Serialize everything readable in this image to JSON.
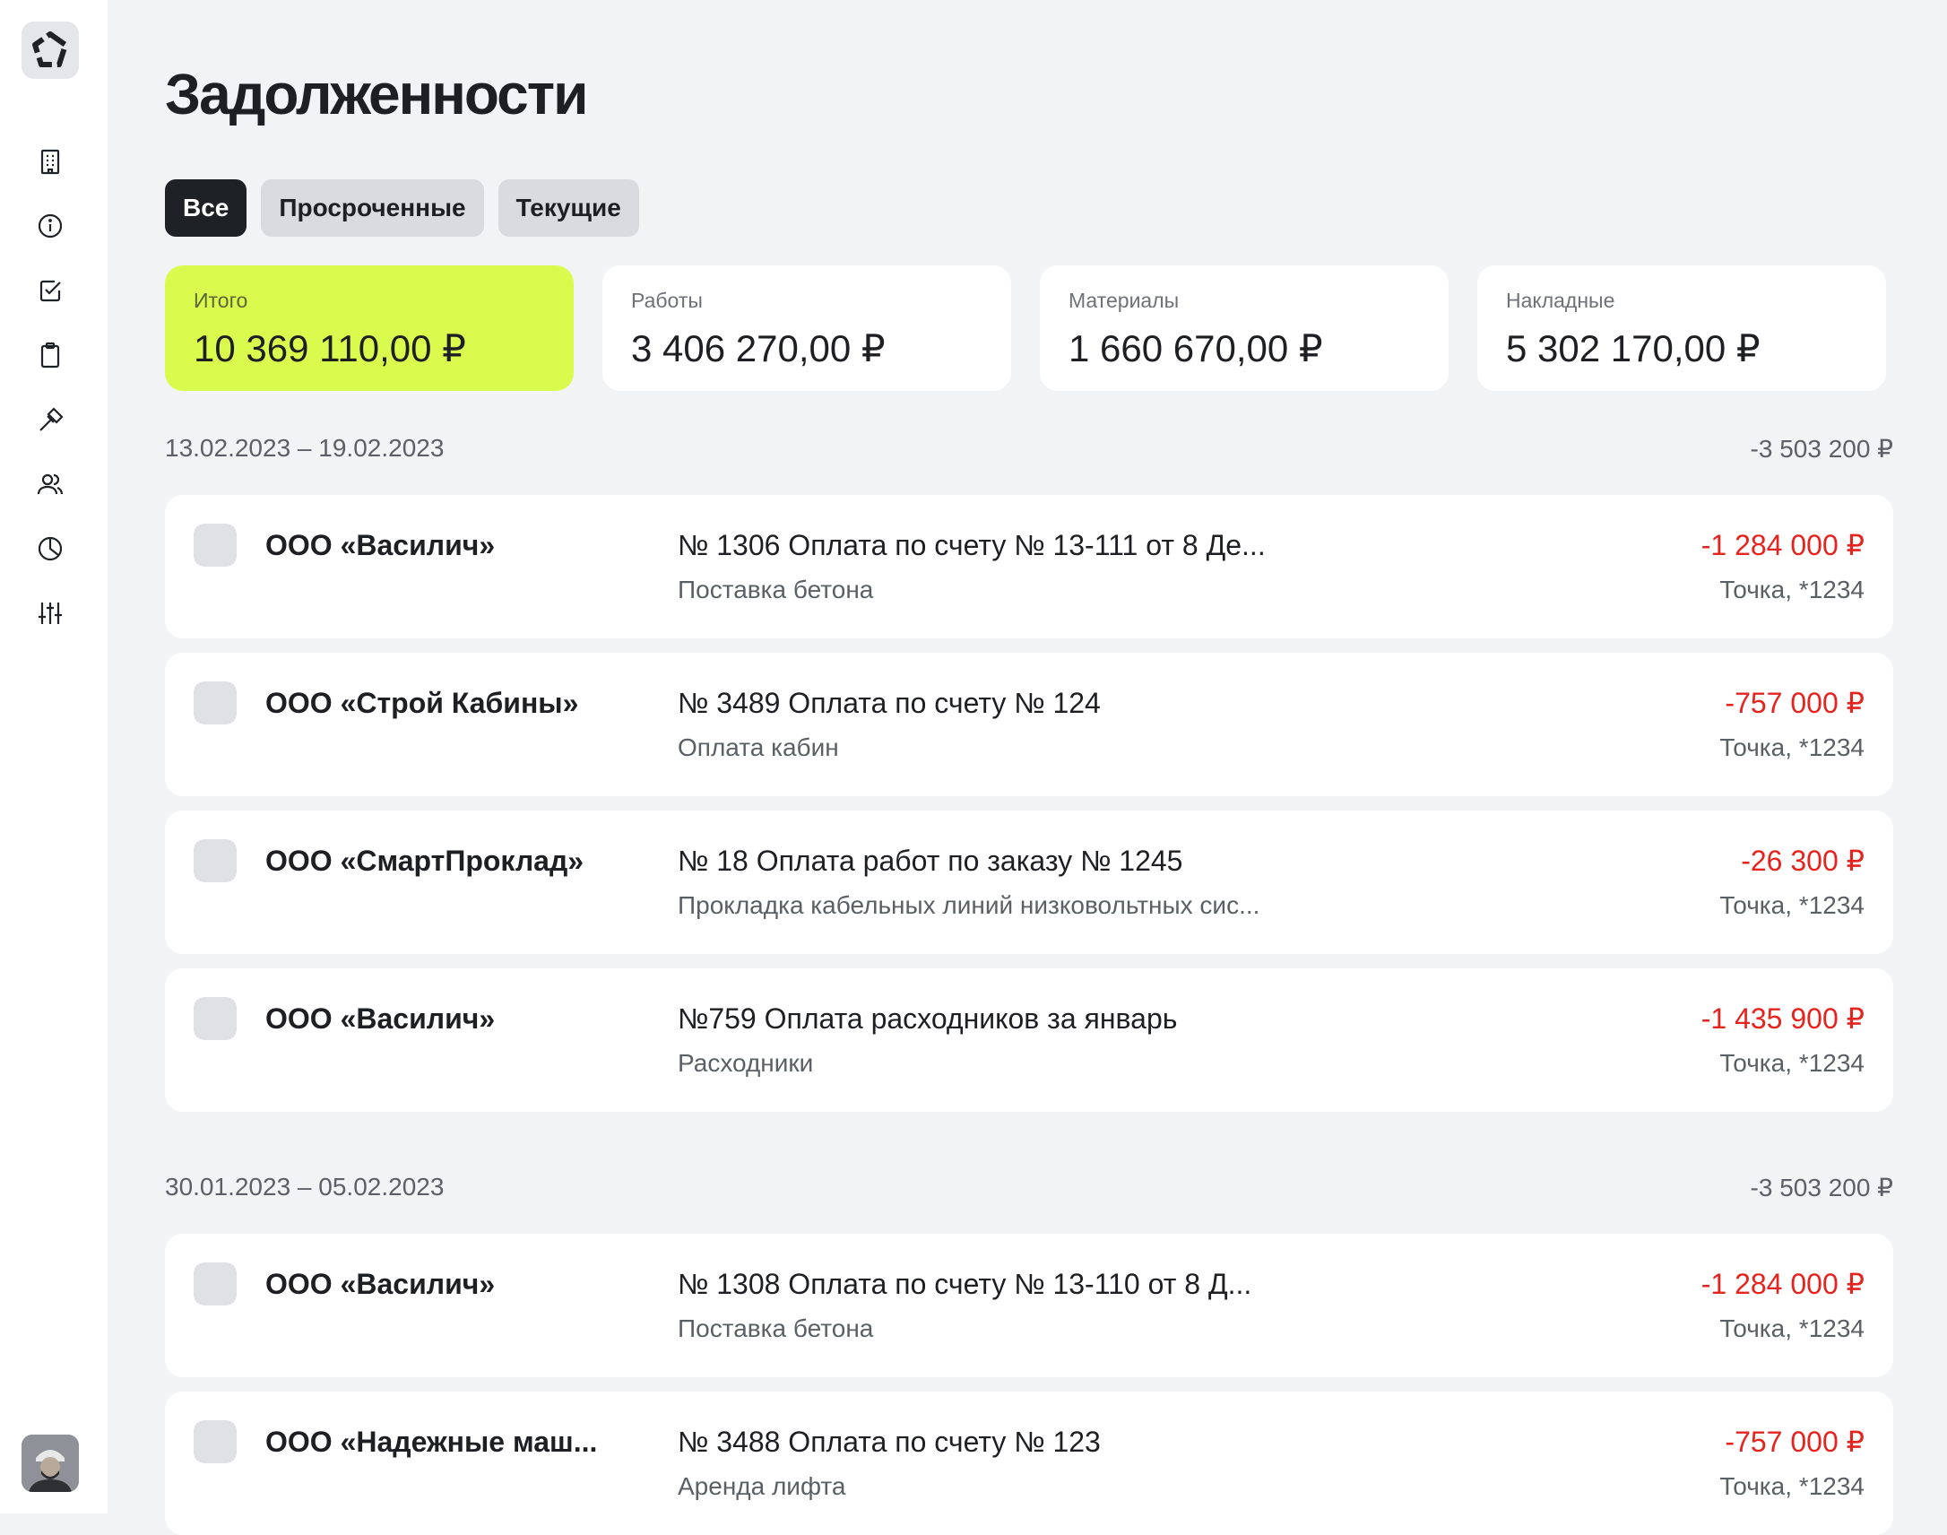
{
  "sidebar": {
    "items": [
      {
        "icon": "building-icon"
      },
      {
        "icon": "info-icon"
      },
      {
        "icon": "checkbox-icon"
      },
      {
        "icon": "clipboard-icon"
      },
      {
        "icon": "hammer-icon"
      },
      {
        "icon": "users-icon"
      },
      {
        "icon": "pie-chart-icon"
      },
      {
        "icon": "sliders-icon"
      }
    ]
  },
  "page": {
    "title": "Задолженности"
  },
  "filters": {
    "all": "Все",
    "overdue": "Просроченные",
    "current": "Текущие",
    "active": "all"
  },
  "summary": [
    {
      "label": "Итого",
      "value": "10 369 110,00 ₽"
    },
    {
      "label": "Работы",
      "value": "3 406 270,00 ₽"
    },
    {
      "label": "Материалы",
      "value": "1 660 670,00 ₽"
    },
    {
      "label": "Накладные",
      "value": "5 302 170,00 ₽"
    }
  ],
  "groups": [
    {
      "period": "13.02.2023 – 19.02.2023",
      "total": "-3 503 200 ₽",
      "rows": [
        {
          "company": "ООО «Василич»",
          "description": "№ 1306 Оплата по счету № 13-111 от 8 Де...",
          "subdescription": "Поставка бетона",
          "amount": "-1 284 000 ₽",
          "account": "Точка, *1234"
        },
        {
          "company": "ООО «Строй Кабины»",
          "description": "№ 3489  Оплата по счету № 124",
          "subdescription": "Оплата кабин",
          "amount": "-757 000 ₽",
          "account": "Точка, *1234"
        },
        {
          "company": "ООО «СмартПроклад»",
          "description": "№ 18 Оплата работ по заказу № 1245",
          "subdescription": "Прокладка кабельных линий низковольтных сис...",
          "amount": "-26 300 ₽",
          "account": "Точка, *1234"
        },
        {
          "company": "ООО «Василич»",
          "description": "№759 Оплата расходников за январь",
          "subdescription": "Расходники",
          "amount": "-1 435 900 ₽",
          "account": "Точка, *1234"
        }
      ]
    },
    {
      "period": "30.01.2023 – 05.02.2023",
      "total": "-3 503 200 ₽",
      "rows": [
        {
          "company": "ООО «Василич»",
          "description": "№ 1308 Оплата по счету № 13-110 от 8 Д...",
          "subdescription": "Поставка бетона",
          "amount": "-1 284 000 ₽",
          "account": "Точка, *1234"
        },
        {
          "company": "ООО «Надежные маш...",
          "description": "№ 3488  Оплата по счету № 123",
          "subdescription": "Аренда лифта",
          "amount": "-757 000 ₽",
          "account": "Точка, *1234"
        }
      ]
    }
  ],
  "colors": {
    "accent": "#d8fb4d",
    "negative": "#e5241f",
    "background": "#f2f3f5",
    "active_tab": "#1e2126"
  }
}
